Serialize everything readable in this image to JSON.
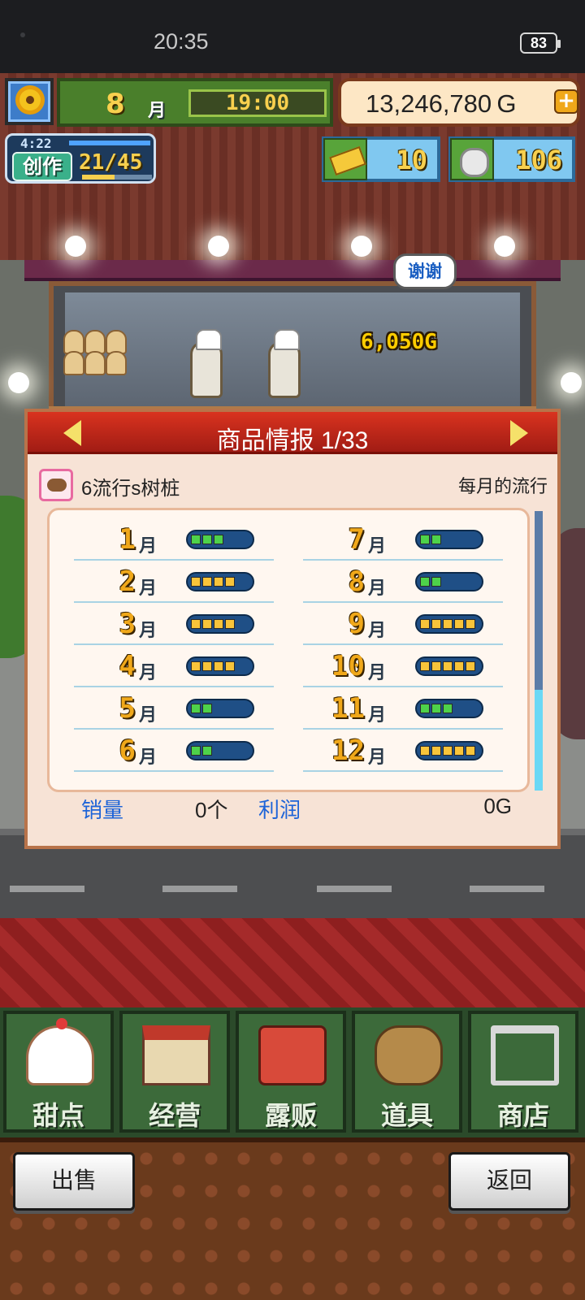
{
  "status_bar": {
    "time": "20:35",
    "battery": "83"
  },
  "hud": {
    "month": "8",
    "month_unit": "月",
    "clock": "19:00",
    "gold": "13,246,780 G",
    "gold_plus": "+",
    "create_timer": "4:22",
    "create_label": "创作",
    "create_count": "21/45",
    "create_progress": 0.47,
    "tickets": "10",
    "coins": "106"
  },
  "scene": {
    "speech_bubble": "谢谢",
    "floating_amount": "6,050G"
  },
  "panel": {
    "title": "商品情报 1/33",
    "item_name": "6流行s树桩",
    "trend_label": "每月的流行",
    "months": [
      {
        "num": "1",
        "unit": "月",
        "level": 3,
        "color": "green"
      },
      {
        "num": "2",
        "unit": "月",
        "level": 4,
        "color": "yellow"
      },
      {
        "num": "3",
        "unit": "月",
        "level": 4,
        "color": "yellow"
      },
      {
        "num": "4",
        "unit": "月",
        "level": 4,
        "color": "yellow"
      },
      {
        "num": "5",
        "unit": "月",
        "level": 2,
        "color": "green"
      },
      {
        "num": "6",
        "unit": "月",
        "level": 2,
        "color": "green"
      },
      {
        "num": "7",
        "unit": "月",
        "level": 2,
        "color": "green"
      },
      {
        "num": "8",
        "unit": "月",
        "level": 2,
        "color": "green"
      },
      {
        "num": "9",
        "unit": "月",
        "level": 5,
        "color": "yellow"
      },
      {
        "num": "10",
        "unit": "月",
        "level": 5,
        "color": "yellow"
      },
      {
        "num": "11",
        "unit": "月",
        "level": 3,
        "color": "green"
      },
      {
        "num": "12",
        "unit": "月",
        "level": 5,
        "color": "yellow"
      }
    ],
    "sales_label": "销量",
    "sales_value": "0个",
    "profit_label": "利润",
    "profit_value": "0G"
  },
  "menu": [
    {
      "label": "甜点",
      "icon": "cake-icon"
    },
    {
      "label": "经营",
      "icon": "shop-icon"
    },
    {
      "label": "露贩",
      "icon": "food-truck-icon"
    },
    {
      "label": "道具",
      "icon": "tools-icon"
    },
    {
      "label": "商店",
      "icon": "cart-icon"
    }
  ],
  "buttons": {
    "sell": "出售",
    "back": "返回"
  },
  "colors": {
    "gauge_green": "#4ed24a",
    "gauge_yellow": "#f8c43a",
    "header_red": "#c62a1a",
    "label_blue": "#1e64d8"
  }
}
